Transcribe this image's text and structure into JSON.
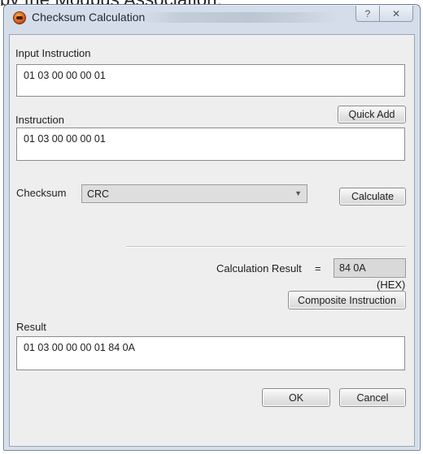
{
  "background_text": "by the Modbus Association.",
  "dialog": {
    "title": "Checksum Calculation",
    "help_glyph": "?",
    "close_glyph": "✕"
  },
  "input_instruction": {
    "label": "Input Instruction",
    "value": "01 03 00 00 00 01"
  },
  "quick_add": {
    "label": "Quick Add"
  },
  "instruction": {
    "label": "Instruction",
    "value": "01 03 00 00 00 01"
  },
  "checksum": {
    "label": "Checksum",
    "selected": "CRC"
  },
  "calculate": {
    "label": "Calculate"
  },
  "calculation_result": {
    "label": "Calculation Result",
    "equals": "=",
    "value": "84 0A",
    "unit": "(HEX)"
  },
  "composite_instruction": {
    "label": "Composite Instruction"
  },
  "result": {
    "label": "Result",
    "value": "01 03 00 00 00 01 84 0A"
  },
  "ok": {
    "label": "OK"
  },
  "cancel": {
    "label": "Cancel"
  },
  "icons": [
    "app-icon",
    "help-icon",
    "close-icon",
    "chevron-down-icon"
  ]
}
